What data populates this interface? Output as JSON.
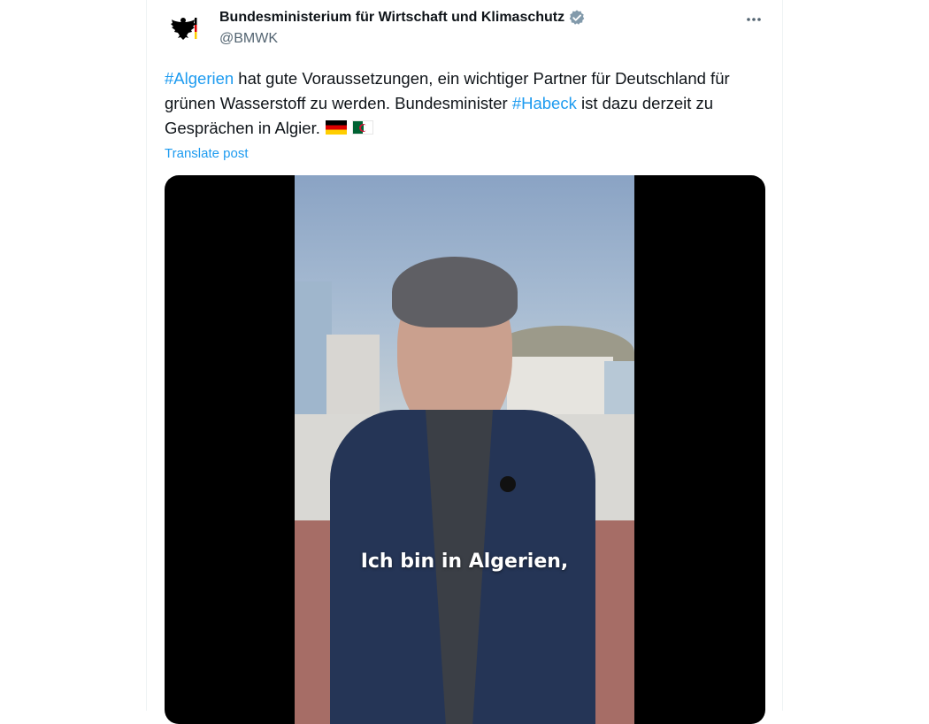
{
  "tweet": {
    "author_name": "Bundesministerium für Wirtschaft und Klimaschutz",
    "handle": "@BMWK",
    "verified_icon": "verified-badge-icon",
    "more_icon": "more-options-icon",
    "text": {
      "hashtag1": "#Algerien",
      "part1": " hat gute Voraussetzungen, ein wichtiger Partner für Deutschland für grünen Wasserstoff zu werden. Bundesminister ",
      "hashtag2": "#Habeck",
      "part2": " ist dazu derzeit zu Gesprächen in Algier."
    },
    "flags": [
      "flag-germany-icon",
      "flag-algeria-icon"
    ],
    "translate_label": "Translate post",
    "video": {
      "subtitle": "Ich bin in Algerien,"
    }
  },
  "colors": {
    "link": "#1d9bf0",
    "text": "#0f1419",
    "secondary": "#536471",
    "verified": "#829aab"
  }
}
